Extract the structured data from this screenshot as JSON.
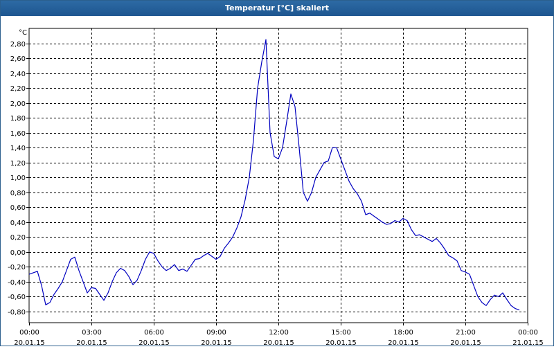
{
  "window": {
    "title": "Temperatur [°C] skaliert"
  },
  "colors": {
    "title_bg": "#1f5a93",
    "series_line": "#0000c0",
    "grid": "#000000"
  },
  "chart_data": {
    "type": "line",
    "title": "Temperatur [°C] skaliert",
    "ylabel": "°C",
    "xlabel": "",
    "ylim": [
      -0.95,
      3.0
    ],
    "grid": true,
    "y_ticks": [
      "2,80",
      "2,60",
      "2,40",
      "2,20",
      "2,00",
      "1,80",
      "1,60",
      "1,40",
      "1,20",
      "1,00",
      "0,80",
      "0,60",
      "0,40",
      "0,20",
      "0,00",
      "-0,20",
      "-0,40",
      "-0,60",
      "-0,80"
    ],
    "y_tick_values": [
      2.8,
      2.6,
      2.4,
      2.2,
      2.0,
      1.8,
      1.6,
      1.4,
      1.2,
      1.0,
      0.8,
      0.6,
      0.4,
      0.2,
      0.0,
      -0.2,
      -0.4,
      -0.6,
      -0.8
    ],
    "x_ticks": [
      {
        "time": "00:00",
        "date": "20.01.15",
        "hour": 0
      },
      {
        "time": "03:00",
        "date": "20.01.15",
        "hour": 3
      },
      {
        "time": "06:00",
        "date": "20.01.15",
        "hour": 6
      },
      {
        "time": "09:00",
        "date": "20.01.15",
        "hour": 9
      },
      {
        "time": "12:00",
        "date": "20.01.15",
        "hour": 12
      },
      {
        "time": "15:00",
        "date": "20.01.15",
        "hour": 15
      },
      {
        "time": "18:00",
        "date": "20.01.15",
        "hour": 18
      },
      {
        "time": "21:00",
        "date": "20.01.15",
        "hour": 21
      },
      {
        "time": "00:00",
        "date": "21.01.15",
        "hour": 24
      }
    ],
    "xlim_hours": [
      0,
      24
    ],
    "series": [
      {
        "points": [
          [
            0.0,
            -0.3
          ],
          [
            0.4,
            -0.26
          ],
          [
            0.6,
            -0.45
          ],
          [
            0.8,
            -0.71
          ],
          [
            1.0,
            -0.68
          ],
          [
            1.2,
            -0.57
          ],
          [
            1.4,
            -0.49
          ],
          [
            1.6,
            -0.4
          ],
          [
            1.8,
            -0.25
          ],
          [
            2.0,
            -0.1
          ],
          [
            2.2,
            -0.07
          ],
          [
            2.4,
            -0.25
          ],
          [
            2.6,
            -0.4
          ],
          [
            2.8,
            -0.55
          ],
          [
            3.0,
            -0.48
          ],
          [
            3.2,
            -0.49
          ],
          [
            3.4,
            -0.57
          ],
          [
            3.6,
            -0.65
          ],
          [
            3.8,
            -0.55
          ],
          [
            4.0,
            -0.4
          ],
          [
            4.2,
            -0.28
          ],
          [
            4.4,
            -0.22
          ],
          [
            4.6,
            -0.25
          ],
          [
            4.8,
            -0.33
          ],
          [
            5.0,
            -0.44
          ],
          [
            5.2,
            -0.38
          ],
          [
            5.4,
            -0.25
          ],
          [
            5.6,
            -0.1
          ],
          [
            5.8,
            0.0
          ],
          [
            6.0,
            -0.02
          ],
          [
            6.2,
            -0.12
          ],
          [
            6.4,
            -0.2
          ],
          [
            6.6,
            -0.25
          ],
          [
            6.8,
            -0.22
          ],
          [
            7.0,
            -0.17
          ],
          [
            7.2,
            -0.25
          ],
          [
            7.4,
            -0.23
          ],
          [
            7.6,
            -0.26
          ],
          [
            7.8,
            -0.18
          ],
          [
            8.0,
            -0.1
          ],
          [
            8.2,
            -0.09
          ],
          [
            8.4,
            -0.05
          ],
          [
            8.6,
            -0.02
          ],
          [
            8.8,
            -0.06
          ],
          [
            9.0,
            -0.1
          ],
          [
            9.2,
            -0.06
          ],
          [
            9.4,
            0.05
          ],
          [
            9.6,
            0.12
          ],
          [
            9.8,
            0.2
          ],
          [
            10.0,
            0.32
          ],
          [
            10.2,
            0.47
          ],
          [
            10.4,
            0.7
          ],
          [
            10.6,
            1.0
          ],
          [
            10.8,
            1.5
          ],
          [
            11.0,
            2.2
          ],
          [
            11.2,
            2.55
          ],
          [
            11.4,
            2.85
          ],
          [
            11.6,
            1.6
          ],
          [
            11.8,
            1.28
          ],
          [
            12.0,
            1.25
          ],
          [
            12.2,
            1.4
          ],
          [
            12.4,
            1.75
          ],
          [
            12.6,
            2.12
          ],
          [
            12.8,
            1.95
          ],
          [
            13.0,
            1.4
          ],
          [
            13.2,
            0.8
          ],
          [
            13.4,
            0.68
          ],
          [
            13.6,
            0.8
          ],
          [
            13.8,
            1.0
          ],
          [
            14.0,
            1.1
          ],
          [
            14.2,
            1.2
          ],
          [
            14.4,
            1.22
          ],
          [
            14.6,
            1.4
          ],
          [
            14.8,
            1.4
          ],
          [
            15.0,
            1.25
          ],
          [
            15.2,
            1.1
          ],
          [
            15.4,
            0.95
          ],
          [
            15.6,
            0.85
          ],
          [
            15.8,
            0.78
          ],
          [
            16.0,
            0.68
          ],
          [
            16.2,
            0.5
          ],
          [
            16.4,
            0.52
          ],
          [
            16.6,
            0.48
          ],
          [
            16.8,
            0.44
          ],
          [
            17.0,
            0.4
          ],
          [
            17.2,
            0.37
          ],
          [
            17.4,
            0.38
          ],
          [
            17.6,
            0.42
          ],
          [
            17.8,
            0.4
          ],
          [
            18.0,
            0.45
          ],
          [
            18.2,
            0.42
          ],
          [
            18.4,
            0.3
          ],
          [
            18.6,
            0.22
          ],
          [
            18.8,
            0.23
          ],
          [
            19.0,
            0.2
          ],
          [
            19.2,
            0.17
          ],
          [
            19.4,
            0.14
          ],
          [
            19.6,
            0.18
          ],
          [
            19.8,
            0.12
          ],
          [
            20.0,
            0.04
          ],
          [
            20.2,
            -0.05
          ],
          [
            20.4,
            -0.08
          ],
          [
            20.6,
            -0.12
          ],
          [
            20.8,
            -0.25
          ],
          [
            21.0,
            -0.27
          ],
          [
            21.2,
            -0.3
          ],
          [
            21.4,
            -0.45
          ],
          [
            21.6,
            -0.6
          ],
          [
            21.8,
            -0.68
          ],
          [
            22.0,
            -0.72
          ],
          [
            22.2,
            -0.64
          ],
          [
            22.4,
            -0.58
          ],
          [
            22.6,
            -0.6
          ],
          [
            22.8,
            -0.55
          ],
          [
            23.0,
            -0.64
          ],
          [
            23.2,
            -0.72
          ],
          [
            23.4,
            -0.76
          ],
          [
            23.6,
            -0.78
          ]
        ]
      }
    ]
  }
}
